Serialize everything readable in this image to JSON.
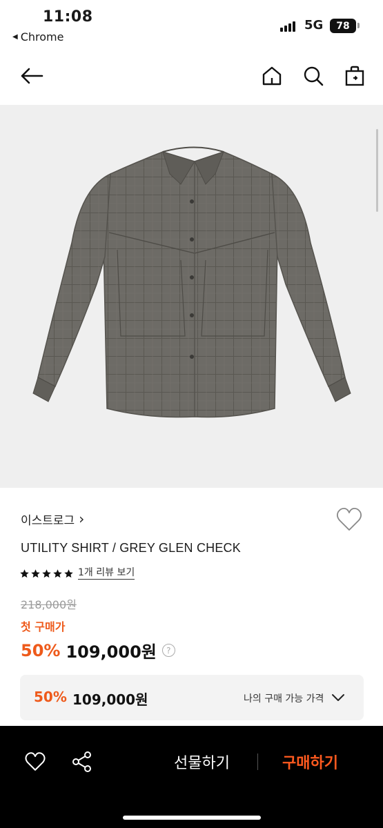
{
  "status_bar": {
    "time": "11:08",
    "back_app": "Chrome",
    "network": "5G",
    "battery": "78"
  },
  "nav": {
    "back_icon": "arrow-left-icon",
    "home_icon": "home-icon",
    "search_icon": "search-icon",
    "cart_icon": "shopping-bag-icon"
  },
  "product": {
    "brand": "이스트로그",
    "brand_chevron": "›",
    "title": "UTILITY SHIRT / GREY GLEN CHECK",
    "rating_stars": 5,
    "review_link": "1개 리뷰 보기",
    "original_price": "218,000원",
    "first_purchase_label": "첫 구매가",
    "discount_percent": "50%",
    "sale_price": "109,000원",
    "info_icon_text": "?"
  },
  "my_price": {
    "discount_percent": "50%",
    "price": "109,000원",
    "label": "나의 구매 가능 가격"
  },
  "bottom_bar": {
    "gift_label": "선물하기",
    "buy_label": "구매하기"
  },
  "colors": {
    "accent": "#ee5a1b",
    "buy_accent": "#ff5a1f",
    "image_bg": "#efefef",
    "bottom_bar_bg": "#000000"
  }
}
